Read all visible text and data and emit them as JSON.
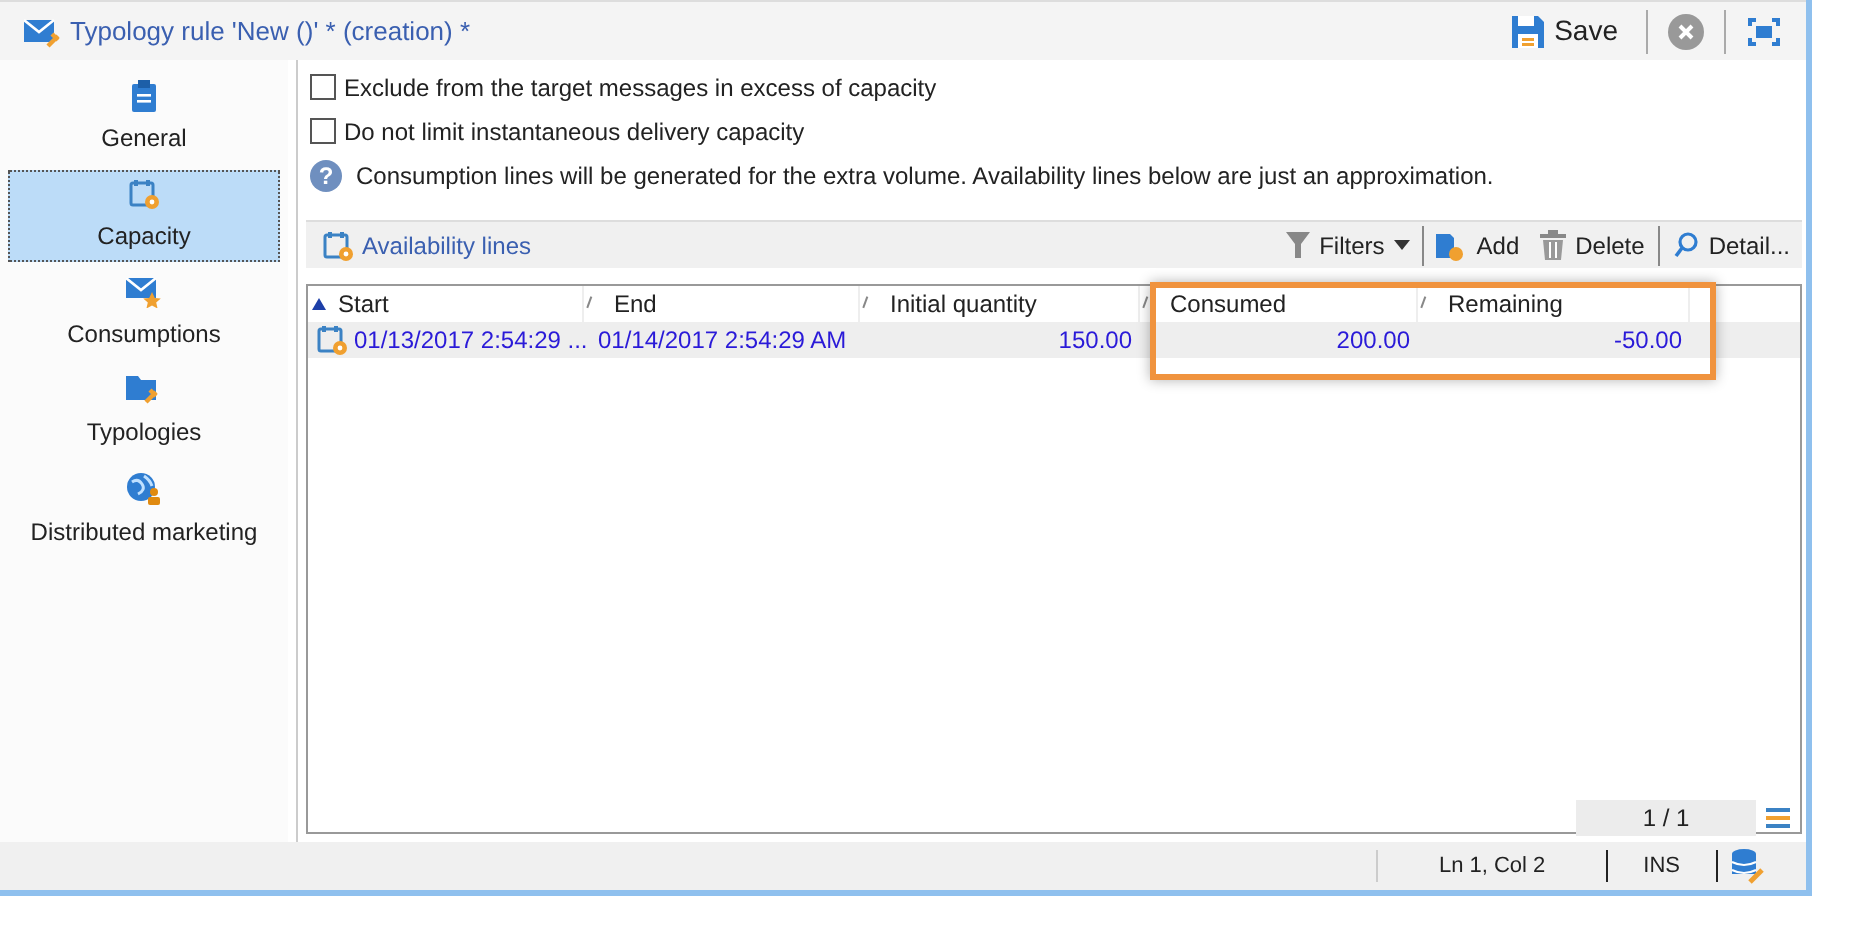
{
  "window": {
    "title": "Typology rule 'New ()' * (creation) *"
  },
  "title_actions": {
    "save": "Save"
  },
  "sidebar": {
    "items": [
      {
        "label": "General",
        "selected": false,
        "kind": "clipboard"
      },
      {
        "label": "Capacity",
        "selected": true,
        "kind": "calendar"
      },
      {
        "label": "Consumptions",
        "selected": false,
        "kind": "envelope"
      },
      {
        "label": "Typologies",
        "selected": false,
        "kind": "folder"
      },
      {
        "label": "Distributed marketing",
        "selected": false,
        "kind": "globe"
      }
    ]
  },
  "options": [
    {
      "label": "Exclude from the target messages in excess of capacity",
      "checked": false
    },
    {
      "label": "Do not limit instantaneous delivery capacity",
      "checked": false
    }
  ],
  "help_mark": "?",
  "info": "Consumption lines will be generated for the extra volume. Availability lines below are just an approximation.",
  "toolbar": {
    "title": "Availability lines",
    "filters": "Filters",
    "add": "Add",
    "delete": "Delete",
    "detail": "Detail..."
  },
  "table": {
    "columns": [
      {
        "label": "Start",
        "sorted": true
      },
      {
        "label": "End",
        "sorted": false
      },
      {
        "label": "Initial quantity",
        "sorted": false
      },
      {
        "label": "Consumed",
        "sorted": false
      },
      {
        "label": "Remaining",
        "sorted": false
      }
    ],
    "rows": [
      {
        "cells": [
          "01/13/2017 2:54:29 ...",
          "01/14/2017 2:54:29 AM",
          "150.00",
          "200.00",
          "-50.00"
        ]
      }
    ],
    "pager": "1 / 1"
  },
  "status_bar": {
    "position": "Ln 1, Col 2",
    "mode": "INS"
  }
}
